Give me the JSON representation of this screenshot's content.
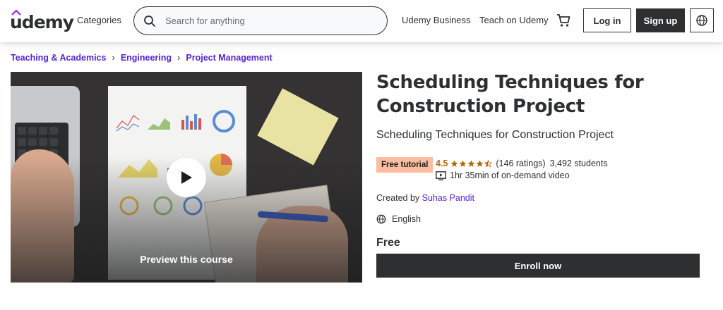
{
  "header": {
    "logo_text": "udemy",
    "categories": "Categories",
    "search_placeholder": "Search for anything",
    "business": "Udemy Business",
    "teach": "Teach on Udemy",
    "login": "Log in",
    "signup": "Sign up"
  },
  "breadcrumb": [
    "Teaching & Academics",
    "Engineering",
    "Project Management"
  ],
  "preview": {
    "label": "Preview this course"
  },
  "course": {
    "title": "Scheduling Techniques for Construction Project",
    "subtitle": "Scheduling Techniques for Construction Project",
    "badge": "Free tutorial",
    "rating": "4.5",
    "ratings_count": "(146 ratings)",
    "students": "3,492 students",
    "video_length": "1hr 35min of on-demand video",
    "created_by_label": "Created by",
    "author": "Suhas Pandit",
    "language": "English",
    "price": "Free",
    "enroll": "Enroll now"
  },
  "colors": {
    "brand_purple": "#5624d0",
    "dark": "#2d2f31",
    "badge_bg": "#fcbca0",
    "star": "#b4690e"
  },
  "icons": {
    "search": "search-icon",
    "cart": "cart-icon",
    "globe": "globe-icon",
    "play": "play-icon",
    "video": "video-icon",
    "star": "star-icon"
  }
}
